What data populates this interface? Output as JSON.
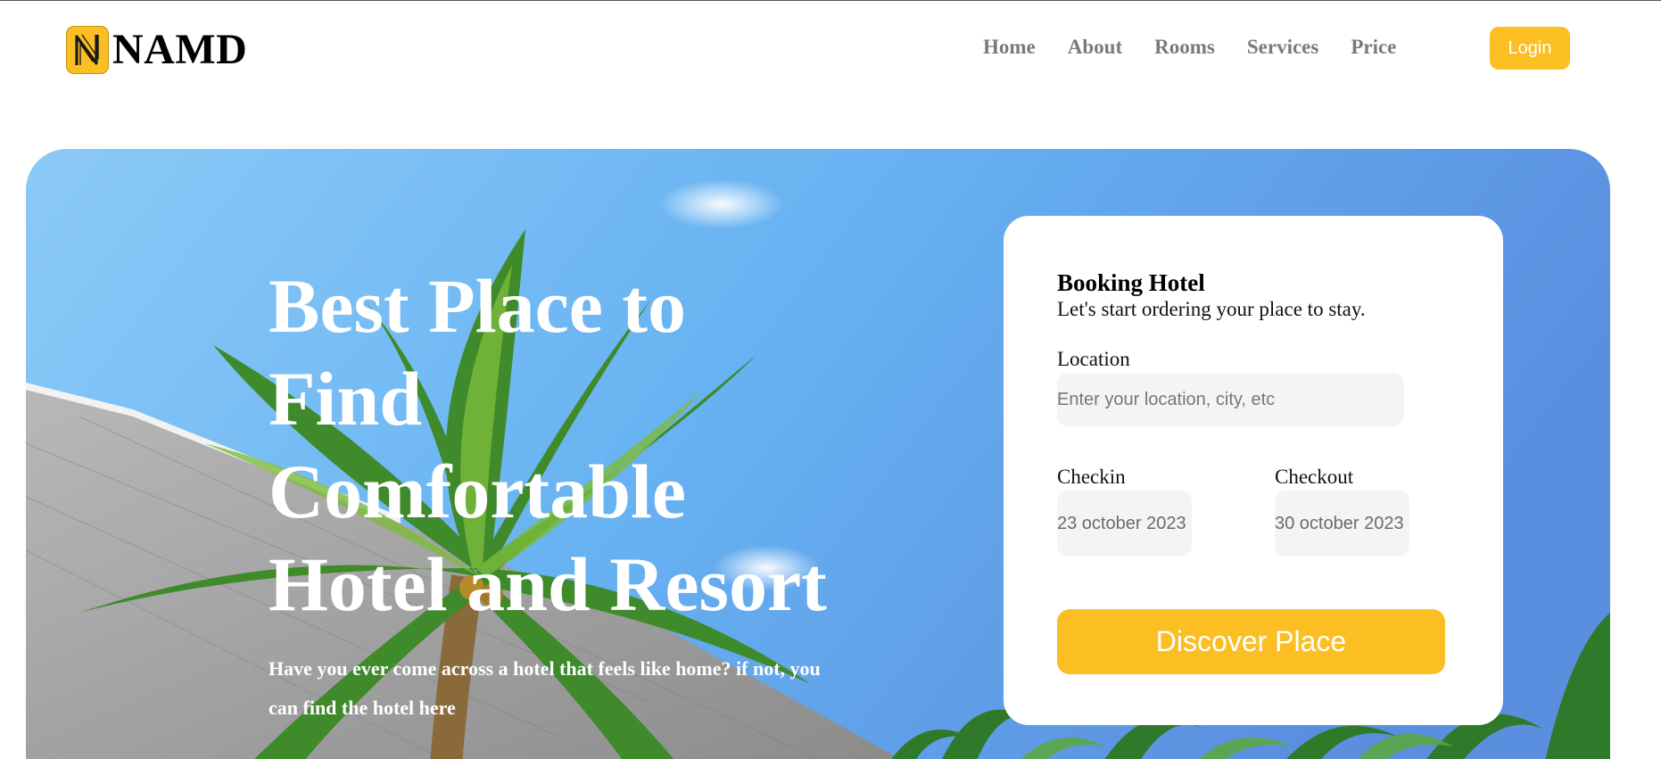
{
  "brand": {
    "name": "NAMD",
    "logo_icon": "n-logo-icon",
    "accent": "#fbbf24"
  },
  "nav": {
    "links": [
      "Home",
      "About",
      "Rooms",
      "Services",
      "Price"
    ],
    "login_label": "Login"
  },
  "hero": {
    "title_lines": [
      "Best Place to",
      "Find",
      "Comfortable",
      "Hotel and Resort"
    ],
    "subtitle": "Have you ever come across a hotel that feels like home? if not, you can find the hotel here"
  },
  "booking": {
    "title": "Booking Hotel",
    "subtitle": "Let's start ordering your place to stay.",
    "location_label": "Location",
    "location_placeholder": "Enter your location, city, etc",
    "checkin_label": "Checkin",
    "checkin_value": "23 october 2023",
    "checkout_label": "Checkout",
    "checkout_value": "30 october 2023",
    "cta_label": "Discover Place"
  }
}
